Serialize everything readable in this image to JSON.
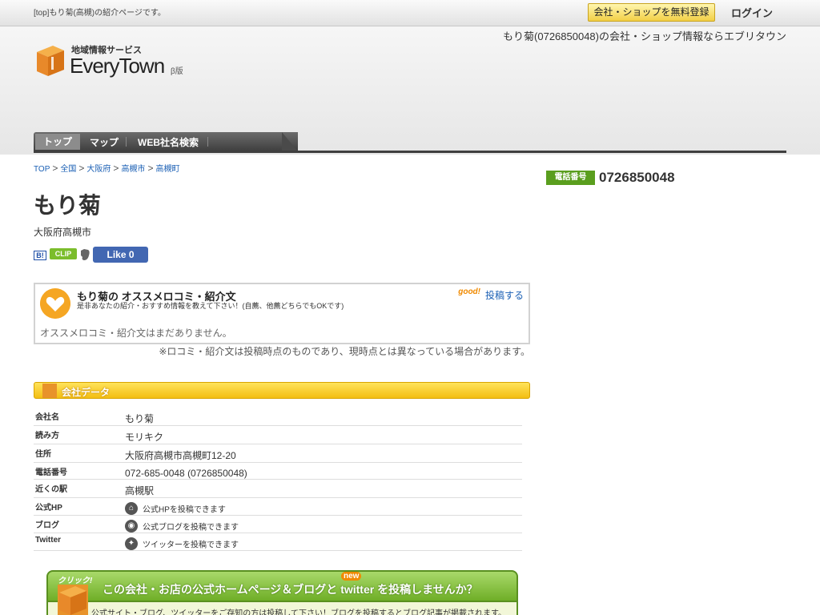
{
  "topbar": {
    "description": "[top]もり菊(高槻)の紹介ページです。",
    "register_label": "会社・ショップを無料登録",
    "login_label": "ログイン"
  },
  "header": {
    "tagline": "もり菊(0726850048)の会社・ショップ情報ならエブリタウン",
    "logo_sub": "地域情報サービス",
    "logo_name": "EveryTown",
    "logo_beta": "β版"
  },
  "nav": {
    "items": [
      {
        "label": "トップ"
      },
      {
        "label": "マップ"
      },
      {
        "label": "WEB社名検索"
      }
    ]
  },
  "breadcrumb": [
    "TOP",
    "全国",
    "大阪府",
    "高槻市",
    "高槻町"
  ],
  "shop": {
    "name": "もり菊",
    "region": "大阪府高槻市"
  },
  "social": {
    "hatena": "B!",
    "clip": "CLIP",
    "fb_like": "Like 0"
  },
  "review": {
    "title": "もり菊の オススメロコミ・紹介文",
    "subtitle": "是非あなたの紹介・おすすめ情報を教えて下さい！(自薦、他薦どちらでもOKです)",
    "good_label": "good!",
    "post_label": "投稿する",
    "empty_text": "オススメロコミ・紹介文はまだありません。",
    "note": "※ロコミ・紹介文は投稿時点のものであり、現時点とは異なっている場合があります。"
  },
  "company": {
    "section_title": "会社データ",
    "rows": [
      {
        "key": "会社名",
        "value": "もり菊"
      },
      {
        "key": "読み方",
        "value": "モリキク"
      },
      {
        "key": "住所",
        "value": "大阪府高槻市高槻町12-20"
      },
      {
        "key": "電話番号",
        "value": "072-685-0048 (0726850048)"
      },
      {
        "key": "近くの駅",
        "value": "高槻駅"
      },
      {
        "key": "公式HP",
        "value": "公式HPを投稿できます"
      },
      {
        "key": "ブログ",
        "value": "公式ブログを投稿できます"
      },
      {
        "key": "Twitter",
        "value": "ツイッターを投稿できます"
      }
    ]
  },
  "phone": {
    "badge": "電話番号",
    "number": "0726850048"
  },
  "promo": {
    "click_label": "クリック!",
    "heading": "この会社・お店の公式ホームページ＆ブログと twitter を投稿しませんか？",
    "new_label": "new",
    "text": "公式サイト・ブログ、ツイッターをご存知の方は投稿して下さい！ブログを投稿するとブログ記事が掲載されます。"
  },
  "colors": {
    "accent_green": "#5a9e1e",
    "link_blue": "#1a5fb4",
    "section_yellow": "#f3be13"
  }
}
